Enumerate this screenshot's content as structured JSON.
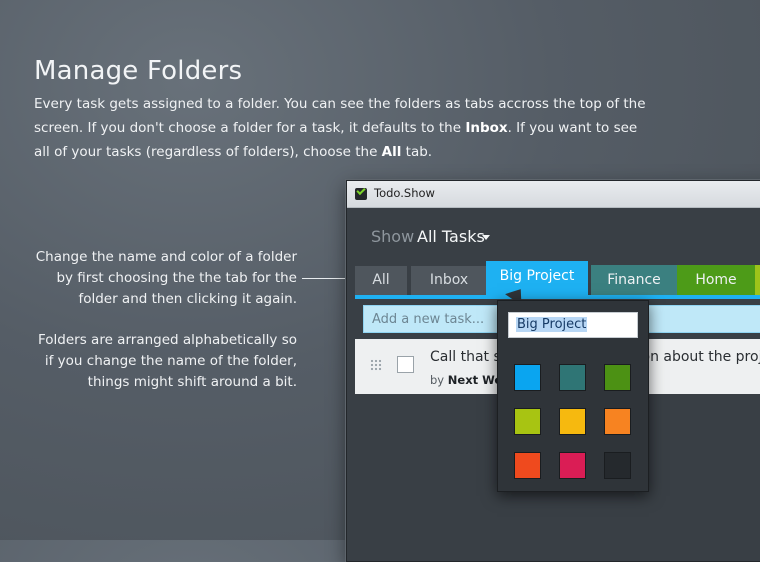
{
  "heading": "Manage Folders",
  "intro": {
    "part1": "Every task gets assigned to a folder. You can see the folders as tabs accross the top of the screen. If you don't choose a folder for a task, it defaults to the ",
    "inbox_word": "Inbox",
    "part2": ". If you want to see all of your tasks (regardless of folders), choose the ",
    "all_word": "All",
    "part3": " tab."
  },
  "notes": {
    "note1": "Change the name and color of a folder by first choosing the the tab for the folder and then clicking it again.",
    "note2": "Folders are arranged alphabetically so if you change the name of the folder, things might shift around a bit."
  },
  "window": {
    "title": "Todo.Show",
    "show_label": "Show",
    "show_value": "All Tasks",
    "tabs": [
      "All",
      "Inbox",
      "Big Project",
      "Finance",
      "Home"
    ],
    "add_placeholder": "Add a new task...",
    "task": {
      "title": "Call that super important person about the project",
      "by": "by",
      "due": "Next Week"
    }
  },
  "popup": {
    "name_value": "Big Project",
    "swatches": [
      "#0aa5f0",
      "#2f7575",
      "#4c9114",
      "#a8c412",
      "#f6b90f",
      "#f78321",
      "#ef4a1e",
      "#da1d55",
      "#25292d"
    ]
  },
  "colors": {
    "accent": "#1eb1f2",
    "finance": "#3b8080",
    "home": "#4d9b18"
  }
}
